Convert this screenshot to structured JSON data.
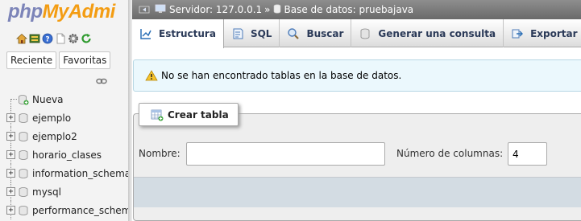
{
  "app": {
    "logo_php": "php",
    "logo_my": "My",
    "logo_admin": "Admi"
  },
  "nav": {
    "icons": [
      "home-icon",
      "database-icon",
      "help-icon",
      "document-icon",
      "settings-icon",
      "reload-icon"
    ],
    "tabs": {
      "recent": "Reciente",
      "favorites": "Favoritas"
    },
    "databases": [
      {
        "name": "Nueva",
        "expandable": false
      },
      {
        "name": "ejemplo",
        "expandable": true
      },
      {
        "name": "ejemplo2",
        "expandable": true
      },
      {
        "name": "horario_clases",
        "expandable": true
      },
      {
        "name": "information_schema",
        "expandable": true
      },
      {
        "name": "mysql",
        "expandable": true
      },
      {
        "name": "performance_schema",
        "expandable": true
      }
    ]
  },
  "breadcrumb": {
    "server_label": "Servidor: 127.0.0.1",
    "separator": "»",
    "database_label": "Base de datos: pruebajava"
  },
  "tabs": {
    "structure": "Estructura",
    "sql": "SQL",
    "search": "Buscar",
    "query": "Generar una consulta",
    "export": "Exportar"
  },
  "notice": {
    "text": "No se han encontrado tablas en la base de datos."
  },
  "create_table": {
    "legend": "Crear tabla",
    "name_label": "Nombre:",
    "name_value": "",
    "columns_label": "Número de columnas:",
    "columns_value": "4"
  },
  "colors": {
    "topbar": "#7a7a7a",
    "notice_bg": "#ebf8fd",
    "logo_accent": "#f39c12",
    "logo_php": "#7c84b8"
  }
}
